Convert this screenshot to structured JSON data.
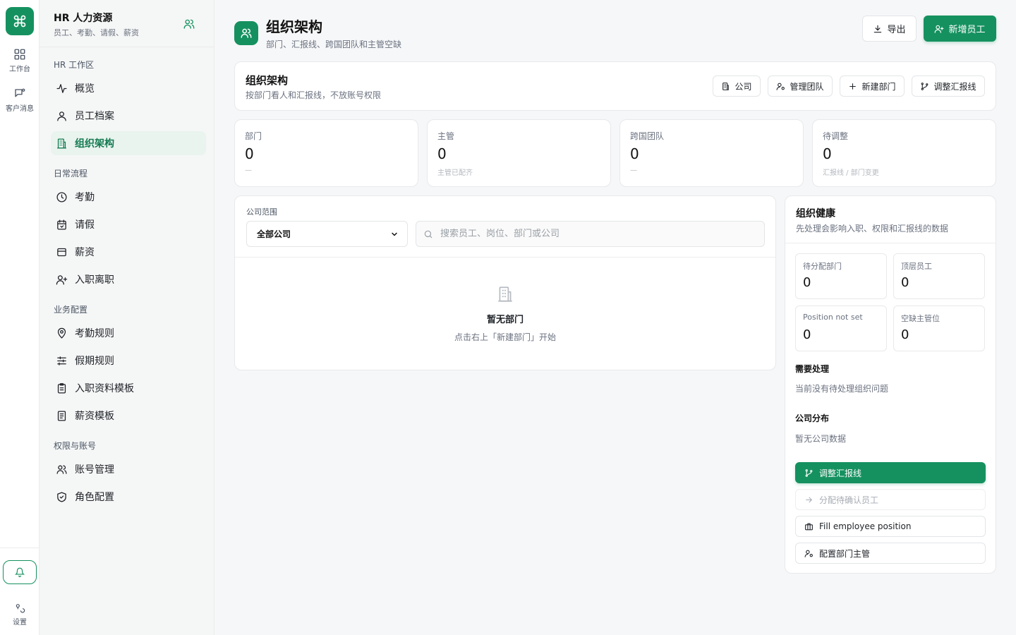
{
  "rail": {
    "items": [
      {
        "label": "工作台",
        "icon": "grid-icon"
      },
      {
        "label": "客户消息",
        "icon": "message-icon"
      }
    ],
    "bottom": {
      "settings_label": "设置"
    }
  },
  "sidebar": {
    "title": "HR 人力资源",
    "subtitle": "员工、考勤、请假、薪资",
    "sections": [
      {
        "label": "HR 工作区",
        "items": [
          {
            "label": "概览",
            "icon": "activity-icon"
          },
          {
            "label": "员工档案",
            "icon": "user-icon"
          },
          {
            "label": "组织架构",
            "icon": "building-icon",
            "active": true
          }
        ]
      },
      {
        "label": "日常流程",
        "items": [
          {
            "label": "考勤",
            "icon": "clock-icon"
          },
          {
            "label": "请假",
            "icon": "calendar-icon"
          },
          {
            "label": "薪资",
            "icon": "wallet-icon"
          },
          {
            "label": "入职离职",
            "icon": "user-plus-icon"
          }
        ]
      },
      {
        "label": "业务配置",
        "items": [
          {
            "label": "考勤规则",
            "icon": "map-pin-icon"
          },
          {
            "label": "假期规则",
            "icon": "sliders-icon"
          },
          {
            "label": "入职资料模板",
            "icon": "clipboard-icon"
          },
          {
            "label": "薪资模板",
            "icon": "file-text-icon"
          }
        ]
      },
      {
        "label": "权限与账号",
        "items": [
          {
            "label": "账号管理",
            "icon": "users-icon"
          },
          {
            "label": "角色配置",
            "icon": "shield-icon"
          }
        ]
      }
    ]
  },
  "header": {
    "title": "组织架构",
    "subtitle": "部门、汇报线、跨国团队和主管空缺",
    "export_label": "导出",
    "add_employee_label": "新增员工"
  },
  "org_card": {
    "title": "组织架构",
    "subtitle": "按部门看人和汇报线，不放账号权限",
    "buttons": {
      "company": "公司",
      "manage_team": "管理团队",
      "new_dept": "新建部门",
      "adjust_report": "调整汇报线"
    }
  },
  "stats": [
    {
      "label": "部门",
      "value": "0",
      "hint": "—"
    },
    {
      "label": "主管",
      "value": "0",
      "hint": "主管已配齐"
    },
    {
      "label": "跨国团队",
      "value": "0",
      "hint": "—"
    },
    {
      "label": "待调整",
      "value": "0",
      "hint": "汇报线 / 部门变更"
    }
  ],
  "filter": {
    "label": "公司范围",
    "select_value": "全部公司",
    "search_placeholder": "搜索员工、岗位、部门或公司"
  },
  "empty": {
    "title": "暂无部门",
    "hint": "点击右上「新建部门」开始"
  },
  "health": {
    "title": "组织健康",
    "subtitle": "先处理会影响入职、权限和汇报线的数据",
    "metrics": [
      {
        "label": "待分配部门",
        "value": "0"
      },
      {
        "label": "顶层员工",
        "value": "0"
      },
      {
        "label": "Position not set",
        "value": "0"
      },
      {
        "label": "空缺主管位",
        "value": "0"
      }
    ],
    "todo_title": "需要处理",
    "todo_text": "当前没有待处理组织问题",
    "dist_title": "公司分布",
    "dist_text": "暂无公司数据",
    "actions": {
      "adjust": "调整汇报线",
      "assign": "分配待确认员工",
      "fill": "Fill employee position",
      "config": "配置部门主管"
    }
  },
  "colors": {
    "accent": "#15915f",
    "accent_bg": "#e9f4ee"
  }
}
